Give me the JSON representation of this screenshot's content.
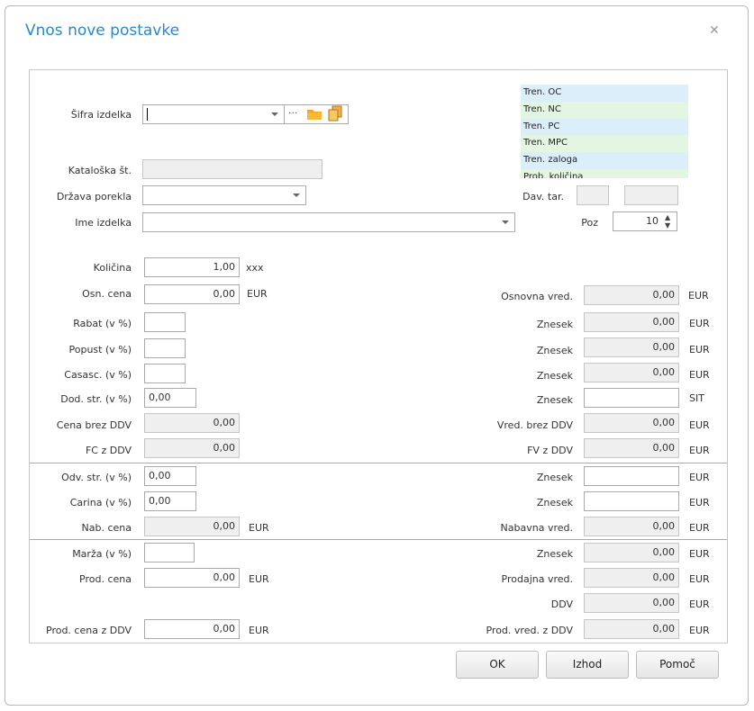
{
  "dialog": {
    "title": "Vnos nove postavke",
    "close_icon": "close-icon"
  },
  "legend": [
    "Tren. OC",
    "Tren. NC",
    "Tren. PC",
    "Tren. MPC",
    "Tren. zaloga",
    "Prob. količina"
  ],
  "legend_colors": [
    "#ddeefb",
    "#e2f6e2"
  ],
  "top": {
    "sifra_label": "Šifra izdelka",
    "sifra_value": "",
    "ellipsis": "···",
    "katalog_label": "Kataloška št.",
    "drzava_label": "Država porekla",
    "ime_label": "Ime izdelka",
    "dav_tar_label": "Dav. tar.",
    "poz_label": "Poz",
    "poz_value": "10"
  },
  "left": {
    "kolicina_label": "Količina",
    "kolicina_value": "1,00",
    "kolicina_unit": "xxx",
    "osn_cena_label": "Osn. cena",
    "osn_cena_value": "0,00",
    "osn_cena_unit": "EUR",
    "rabat_label": "Rabat (v %)",
    "popust_label": "Popust (v %)",
    "casasc_label": "Casasc. (v %)",
    "dod_str_label": "Dod. str. (v %)",
    "dod_str_value": "0,00",
    "cena_brez_label": "Cena brez DDV",
    "cena_brez_value": "0,00",
    "fc_label": "FC z DDV",
    "fc_value": "0,00",
    "odv_str_label": "Odv. str. (v %)",
    "odv_str_value": "0,00",
    "carina_label": "Carina (v %)",
    "carina_value": "0,00",
    "nab_cena_label": "Nab. cena",
    "nab_cena_value": "0,00",
    "nab_cena_unit": "EUR",
    "marza_label": "Marža (v %)",
    "prod_cena_label": "Prod. cena",
    "prod_cena_value": "0,00",
    "prod_cena_unit": "EUR",
    "prod_cena_ddv_label": "Prod. cena z DDV",
    "prod_cena_ddv_value": "0,00",
    "prod_cena_ddv_unit": "EUR"
  },
  "right": {
    "osnovna_label": "Osnovna vred.",
    "osnovna_value": "0,00",
    "osnovna_unit": "EUR",
    "znesek_label": "Znesek",
    "z1_value": "0,00",
    "z1_unit": "EUR",
    "z2_value": "0,00",
    "z2_unit": "EUR",
    "z3_value": "0,00",
    "z3_unit": "EUR",
    "z4_unit": "SIT",
    "vred_brez_label": "Vred. brez DDV",
    "vred_brez_value": "0,00",
    "vred_brez_unit": "EUR",
    "fv_label": "FV z DDV",
    "fv_value": "0,00",
    "fv_unit": "EUR",
    "z5_unit": "EUR",
    "z6_unit": "EUR",
    "nabavna_label": "Nabavna vred.",
    "nabavna_value": "0,00",
    "nabavna_unit": "EUR",
    "z7_value": "0,00",
    "z7_unit": "EUR",
    "prodajna_label": "Prodajna vred.",
    "prodajna_value": "0,00",
    "prodajna_unit": "EUR",
    "ddv_label": "DDV",
    "ddv_value": "0,00",
    "ddv_unit": "EUR",
    "prod_vred_label": "Prod. vred. z DDV",
    "prod_vred_value": "0,00",
    "prod_vred_unit": "EUR"
  },
  "buttons": {
    "ok": "OK",
    "izhod": "Izhod",
    "pomoc": "Pomoč"
  }
}
